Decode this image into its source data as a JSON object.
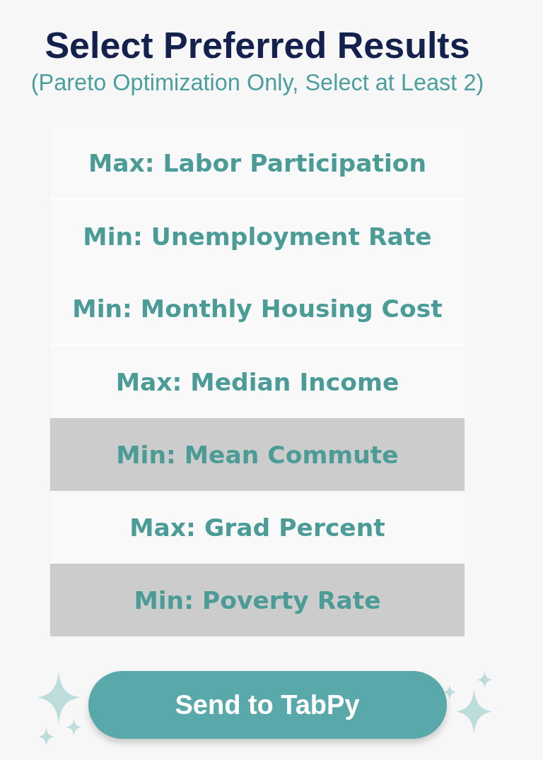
{
  "title": "Select Preferred Results",
  "subtitle": "(Pareto Optimization Only, Select at Least 2)",
  "options": [
    {
      "label": "Max: Labor Participation",
      "selected": false,
      "rule_below": true
    },
    {
      "label": "Min: Unemployment Rate",
      "selected": false,
      "rule_below": false
    },
    {
      "label": "Min: Monthly Housing Cost",
      "selected": false,
      "rule_below": true
    },
    {
      "label": "Max: Median Income",
      "selected": false,
      "rule_below": false
    },
    {
      "label": "Min: Mean Commute",
      "selected": true,
      "rule_below": false
    },
    {
      "label": "Max: Grad Percent",
      "selected": false,
      "rule_below": false
    },
    {
      "label": "Min: Poverty Rate",
      "selected": true,
      "rule_below": false
    }
  ],
  "submit_button": {
    "label": "Send to TabPy"
  }
}
